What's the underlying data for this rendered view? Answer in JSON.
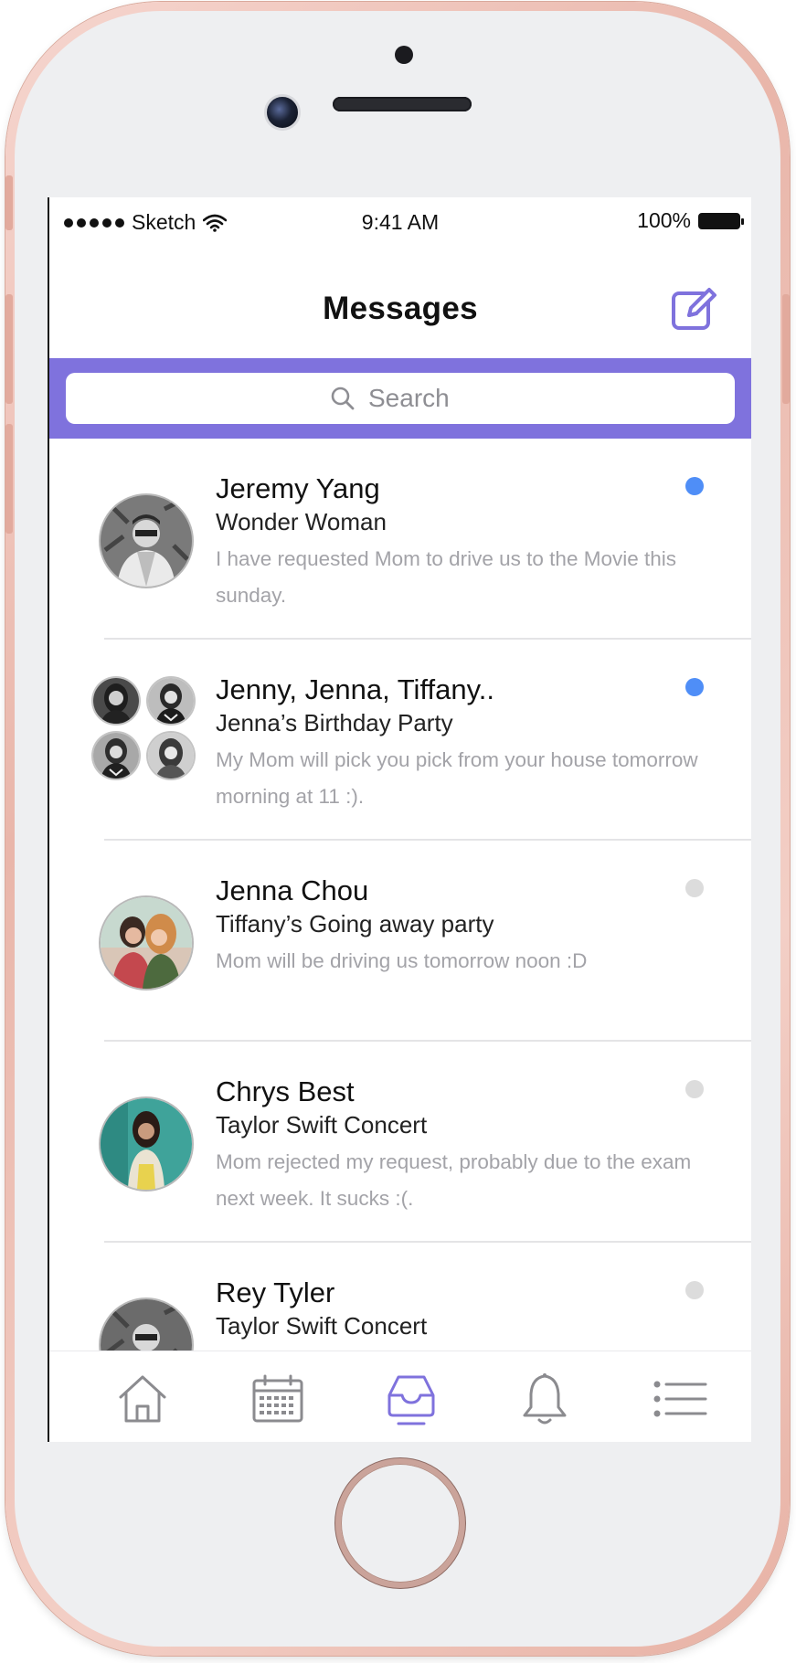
{
  "status_bar": {
    "carrier": "Sketch",
    "time": "9:41 AM",
    "battery": "100%"
  },
  "nav": {
    "title": "Messages"
  },
  "search": {
    "placeholder": "Search"
  },
  "colors": {
    "accent": "#7f72dd",
    "unread_dot": "#4f8ef7",
    "read_dot": "#dcdcdc"
  },
  "messages": [
    {
      "name": "Jeremy Yang",
      "subject": "Wonder Woman",
      "preview": "I have requested Mom to drive us to the Movie this sunday.",
      "unread": true
    },
    {
      "name": "Jenny, Jenna, Tiffany..",
      "subject": "Jenna’s Birthday Party",
      "preview": "My Mom will pick you pick from your house tomorrow morning at 11 :).",
      "unread": true
    },
    {
      "name": "Jenna Chou",
      "subject": "Tiffany’s Going away party",
      "preview": "Mom will be driving us tomorrow noon :D",
      "unread": false
    },
    {
      "name": "Chrys Best",
      "subject": "Taylor Swift Concert",
      "preview": "Mom rejected my request, probably due to the exam next week. It sucks :(.",
      "unread": false
    },
    {
      "name": "Rey Tyler",
      "subject": "Taylor Swift Concert",
      "preview": "",
      "unread": false
    }
  ],
  "tabs": [
    {
      "icon": "home-icon",
      "active": false
    },
    {
      "icon": "calendar-icon",
      "active": false
    },
    {
      "icon": "inbox-icon",
      "active": true
    },
    {
      "icon": "bell-icon",
      "active": false
    },
    {
      "icon": "list-icon",
      "active": false
    }
  ]
}
